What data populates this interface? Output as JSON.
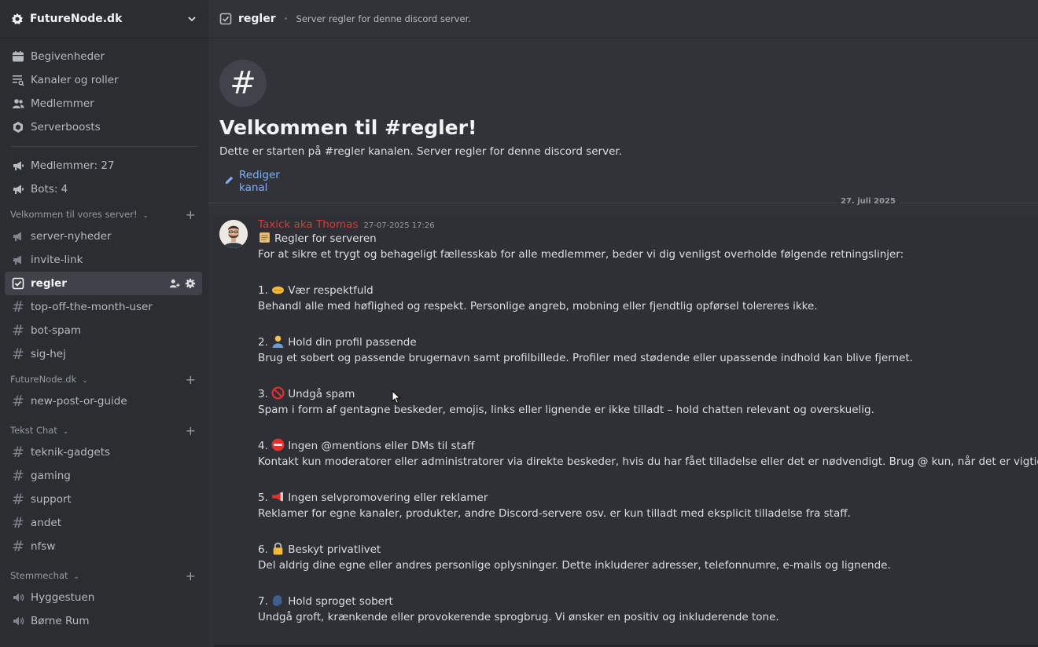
{
  "server": {
    "name": "FutureNode.dk"
  },
  "sidebar": {
    "top_items": [
      {
        "label": "Begivenheder",
        "icon": "calendar-icon"
      },
      {
        "label": "Kanaler og roller",
        "icon": "channels-browse-icon"
      },
      {
        "label": "Medlemmer",
        "icon": "members-icon"
      },
      {
        "label": "Serverboosts",
        "icon": "boost-icon"
      }
    ],
    "stats": [
      {
        "label": "Medlemmer: 27",
        "icon": "megaphone-icon"
      },
      {
        "label": "Bots: 4",
        "icon": "megaphone-icon"
      }
    ],
    "categories": [
      {
        "name": "Velkommen til vores server!",
        "channels": [
          {
            "label": "server-nyheder",
            "type": "announcement"
          },
          {
            "label": "invite-link",
            "type": "announcement"
          },
          {
            "label": "regler",
            "type": "rules",
            "active": true
          },
          {
            "label": "top-off-the-month-user",
            "type": "text"
          },
          {
            "label": "bot-spam",
            "type": "text"
          },
          {
            "label": "sig-hej",
            "type": "text"
          }
        ]
      },
      {
        "name": "FutureNode.dk",
        "channels": [
          {
            "label": "new-post-or-guide",
            "type": "text"
          }
        ]
      },
      {
        "name": "Tekst Chat",
        "channels": [
          {
            "label": "teknik-gadgets",
            "type": "text"
          },
          {
            "label": "gaming",
            "type": "text"
          },
          {
            "label": "support",
            "type": "text"
          },
          {
            "label": "andet",
            "type": "text"
          },
          {
            "label": "nfsw",
            "type": "text"
          }
        ]
      },
      {
        "name": "Stemmechat",
        "channels": [
          {
            "label": "Hyggestuen",
            "type": "voice"
          },
          {
            "label": "Børne Rum",
            "type": "voice"
          }
        ]
      }
    ]
  },
  "topbar": {
    "channel": "regler",
    "topic": "Server regler for denne discord server."
  },
  "welcome": {
    "hash": "#",
    "title": "Velkommen til #regler!",
    "description": "Dette er starten på #regler kanalen. Server regler for denne discord server.",
    "edit_label": "Rediger kanal"
  },
  "date_divider": "27. juli 2025",
  "message": {
    "author": "Taxick aka Thomas",
    "timestamp": "27-07-2025 17:26",
    "heading": "Regler for serveren",
    "intro": "For at sikre et trygt og behageligt fællesskab for alle medlemmer, beder vi dig venligst overholde følgende retningslinjer:",
    "rules": [
      {
        "num": "1.",
        "emoji": "handshake",
        "title": "Vær respektfuld",
        "text": "Behandl alle med høflighed og respekt. Personlige angreb, mobning eller fjendtlig opførsel tolereres ikke."
      },
      {
        "num": "2.",
        "emoji": "person",
        "title": "Hold din profil passende",
        "text": "Brug et sobert og passende brugernavn samt profilbillede. Profiler med stødende eller upassende indhold kan blive fjernet."
      },
      {
        "num": "3.",
        "emoji": "prohibited",
        "title": "Undgå spam",
        "text": "Spam i form af gentagne beskeder, emojis, links eller lignende er ikke tilladt – hold chatten relevant og overskuelig."
      },
      {
        "num": "4.",
        "emoji": "no-entry",
        "title": "Ingen @mentions eller DMs til staff",
        "text": "Kontakt kun moderatorer eller administratorer via direkte beskeder, hvis du har fået tilladelse eller det er nødvendigt. Brug @ kun, når det er vigtigt."
      },
      {
        "num": "5.",
        "emoji": "megaphone",
        "title": "Ingen selvpromovering eller reklamer",
        "text": "Reklamer for egne kanaler, produkter, andre Discord-servere osv. er kun tilladt med eksplicit tilladelse fra staff."
      },
      {
        "num": "6.",
        "emoji": "lock",
        "title": "Beskyt privatlivet",
        "text": "Del aldrig dine egne eller andres personlige oplysninger. Dette inkluderer adresser, telefonnumre, e-mails og lignende."
      },
      {
        "num": "7.",
        "emoji": "speaking-head",
        "title": "Hold sproget sobert",
        "text": "Undgå groft, krænkende eller provokerende sprogbrug. Vi ønsker en positiv og inkluderende tone."
      }
    ]
  },
  "colors": {
    "sidebar_bg": "#2b2d31",
    "main_bg": "#313338",
    "author_red": "#d63a3a",
    "link_blue": "#7fb0ff"
  }
}
